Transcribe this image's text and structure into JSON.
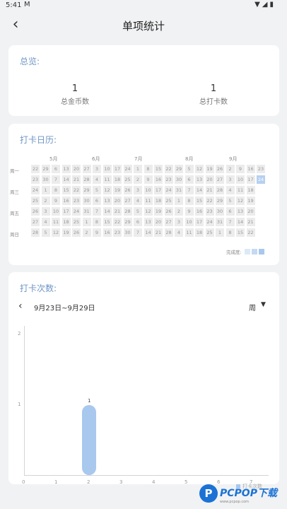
{
  "status_bar": {
    "time": "5:41",
    "mail_icon": "M"
  },
  "header": {
    "title": "单项统计"
  },
  "overview": {
    "title": "总览:",
    "items": [
      {
        "value": "1",
        "label": "总金币数"
      },
      {
        "value": "1",
        "label": "总打卡数"
      }
    ]
  },
  "calendar": {
    "title": "打卡日历:",
    "months": [
      "5月",
      "6月",
      "7月",
      "8月",
      "9月"
    ],
    "weekdays": [
      "周一",
      "周三",
      "周五",
      "周日"
    ],
    "rows": [
      [
        "22",
        "29",
        "6",
        "13",
        "20",
        "27",
        "3",
        "10",
        "17",
        "24",
        "1",
        "8",
        "15",
        "22",
        "29",
        "5",
        "12",
        "19",
        "26",
        "2",
        "9",
        "16",
        "23"
      ],
      [
        "23",
        "30",
        "7",
        "14",
        "21",
        "28",
        "4",
        "11",
        "18",
        "25",
        "2",
        "9",
        "16",
        "23",
        "30",
        "6",
        "13",
        "20",
        "27",
        "3",
        "10",
        "17",
        "24"
      ],
      [
        "24",
        "1",
        "8",
        "15",
        "22",
        "29",
        "5",
        "12",
        "19",
        "26",
        "3",
        "10",
        "17",
        "24",
        "31",
        "7",
        "14",
        "21",
        "28",
        "4",
        "11",
        "18"
      ],
      [
        "25",
        "2",
        "9",
        "16",
        "23",
        "30",
        "6",
        "13",
        "20",
        "27",
        "4",
        "11",
        "18",
        "25",
        "1",
        "8",
        "15",
        "22",
        "29",
        "5",
        "12",
        "19"
      ],
      [
        "26",
        "3",
        "10",
        "17",
        "24",
        "31",
        "7",
        "14",
        "21",
        "28",
        "5",
        "12",
        "19",
        "26",
        "2",
        "9",
        "16",
        "23",
        "30",
        "6",
        "13",
        "20"
      ],
      [
        "27",
        "4",
        "11",
        "18",
        "25",
        "1",
        "8",
        "15",
        "22",
        "29",
        "6",
        "13",
        "20",
        "27",
        "3",
        "10",
        "17",
        "24",
        "31",
        "7",
        "14",
        "21"
      ],
      [
        "28",
        "5",
        "12",
        "19",
        "26",
        "2",
        "9",
        "16",
        "23",
        "30",
        "7",
        "14",
        "21",
        "28",
        "4",
        "11",
        "18",
        "25",
        "1",
        "8",
        "15",
        "22"
      ]
    ],
    "legend_label": "完成度:",
    "legend_colors": [
      "#dde9f7",
      "#c4d9f2",
      "#a8c8ee"
    ]
  },
  "checkins": {
    "title": "打卡次数:",
    "date_range": "9月23日~9月29日",
    "period": "周"
  },
  "chart_data": {
    "type": "bar",
    "x": [
      0,
      1,
      2,
      3,
      4,
      5,
      6,
      7
    ],
    "x_tick_labels": [
      "0",
      "1",
      "2",
      "3",
      "4",
      "5",
      "6",
      "7"
    ],
    "y_tick_labels": [
      "1",
      "2"
    ],
    "ylim": [
      0,
      2
    ],
    "xlim": [
      0,
      7
    ],
    "series": [
      {
        "name": "打卡次数",
        "points": [
          {
            "x": 2,
            "y": 1,
            "label": "1"
          }
        ]
      }
    ],
    "bar_color": "#a8c8ee"
  },
  "watermark": {
    "text": "PCPOP下载",
    "sub": "www.pcpop.com",
    "letter": "P"
  }
}
